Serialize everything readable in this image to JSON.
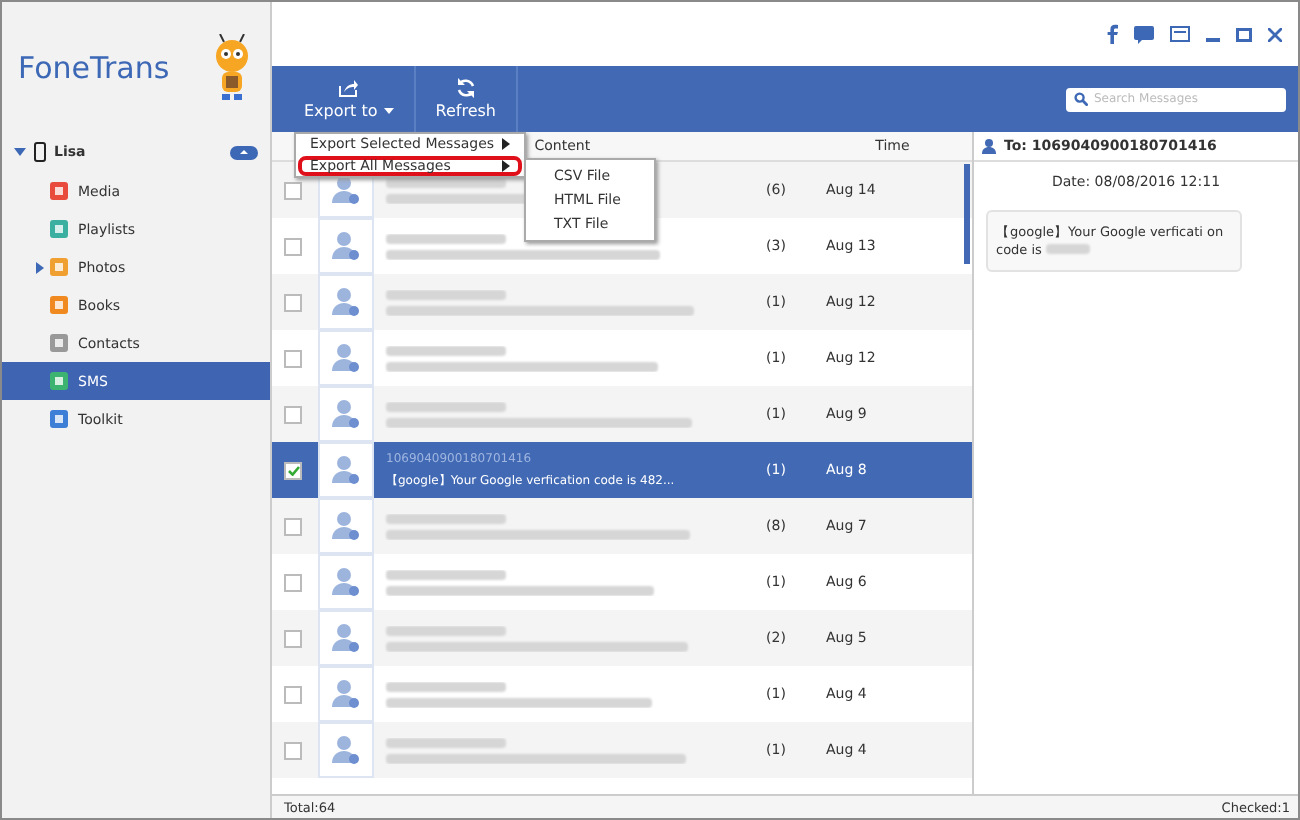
{
  "app": {
    "name": "FoneTrans"
  },
  "device": {
    "name": "Lisa",
    "expanded": true
  },
  "sidebar": {
    "items": [
      {
        "label": "Media",
        "selected": false
      },
      {
        "label": "Playlists",
        "selected": false
      },
      {
        "label": "Photos",
        "selected": false,
        "expandable": true
      },
      {
        "label": "Books",
        "selected": false
      },
      {
        "label": "Contacts",
        "selected": false
      },
      {
        "label": "SMS",
        "selected": true
      },
      {
        "label": "Toolkit",
        "selected": false
      }
    ]
  },
  "toolbar": {
    "buttons": [
      {
        "label": "Export to",
        "kind": "export"
      },
      {
        "label": "Refresh",
        "kind": "refresh"
      }
    ]
  },
  "search": {
    "placeholder": "Search Messages"
  },
  "export_menu": {
    "items": [
      {
        "label": "Export Selected Messages",
        "highlighted": false
      },
      {
        "label": "Export All Messages",
        "highlighted": true
      }
    ],
    "submenu": [
      "CSV File",
      "HTML File",
      "TXT File"
    ]
  },
  "table": {
    "columns": [
      "Content",
      "Time"
    ],
    "rows": [
      {
        "count": "(6)",
        "time": "Aug 14",
        "checked": false,
        "selected": false
      },
      {
        "count": "(3)",
        "time": "Aug 13",
        "checked": false,
        "selected": false
      },
      {
        "count": "(1)",
        "time": "Aug 12",
        "checked": false,
        "selected": false
      },
      {
        "count": "(1)",
        "time": "Aug 12",
        "checked": false,
        "selected": false
      },
      {
        "count": "(1)",
        "time": "Aug 9",
        "checked": false,
        "selected": false
      },
      {
        "count": "(1)",
        "time": "Aug 8",
        "checked": true,
        "selected": true,
        "number": "1069040900180701416",
        "content": "【google】Your Google verfication code is 482..."
      },
      {
        "count": "(8)",
        "time": "Aug 7",
        "checked": false,
        "selected": false
      },
      {
        "count": "(1)",
        "time": "Aug 6",
        "checked": false,
        "selected": false
      },
      {
        "count": "(2)",
        "time": "Aug 5",
        "checked": false,
        "selected": false
      },
      {
        "count": "(1)",
        "time": "Aug 4",
        "checked": false,
        "selected": false
      },
      {
        "count": "(1)",
        "time": "Aug 4",
        "checked": false,
        "selected": false
      }
    ]
  },
  "detail": {
    "to": "To: 1069040900180701416",
    "date": "Date: 08/08/2016 12:11",
    "message": "【google】Your Google verficati on code is"
  },
  "status_bar": {
    "total": "Total:64",
    "checked": "Checked:1"
  }
}
